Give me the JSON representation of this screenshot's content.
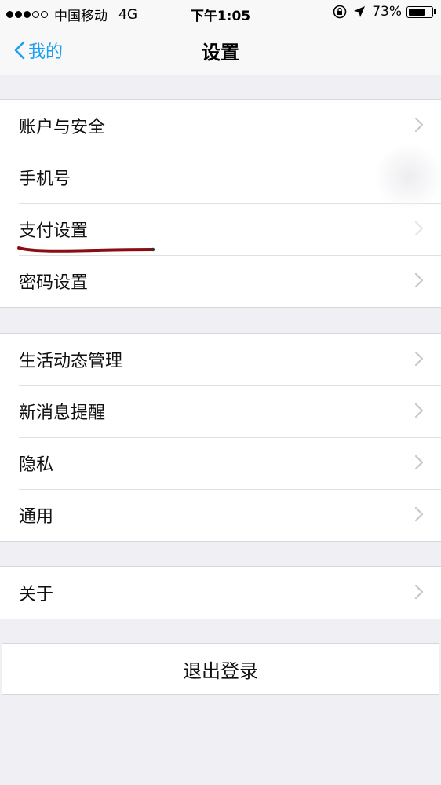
{
  "status_bar": {
    "carrier": "中国移动",
    "network": "4G",
    "time": "下午1:05",
    "battery": "73%",
    "battery_level": 0.73
  },
  "nav": {
    "back_label": "我的",
    "title": "设置"
  },
  "groups": [
    {
      "items": [
        "账户与安全",
        "手机号",
        "支付设置",
        "密码设置"
      ]
    },
    {
      "items": [
        "生活动态管理",
        "新消息提醒",
        "隐私",
        "通用"
      ]
    },
    {
      "items": [
        "关于"
      ]
    }
  ],
  "logout_label": "退出登录",
  "colors": {
    "accent": "#1a9ff0",
    "background": "#efeff4",
    "annotation": "#8b0d14"
  }
}
